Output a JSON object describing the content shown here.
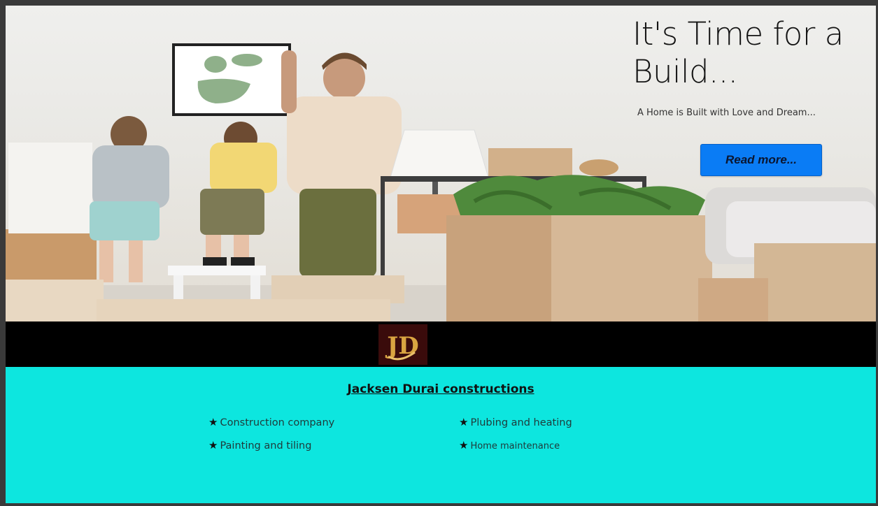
{
  "hero": {
    "title": "It's Time for a Build...",
    "subtitle": "A Home is Built with Love and Dream...",
    "read_more_label": "Read more..."
  },
  "brand": {
    "logo_initials": "JD",
    "company_name": "Jacksen Durai constructions"
  },
  "services": [
    {
      "label": "Construction company"
    },
    {
      "label": "Painting and tiling"
    },
    {
      "label": "Plubing and heating"
    },
    {
      "label": "Home maintenance"
    }
  ],
  "colors": {
    "button_blue": "#0a7cf5",
    "info_background": "#0de6df",
    "logo_bar": "#000000",
    "logo_gold": "#d9a441"
  }
}
